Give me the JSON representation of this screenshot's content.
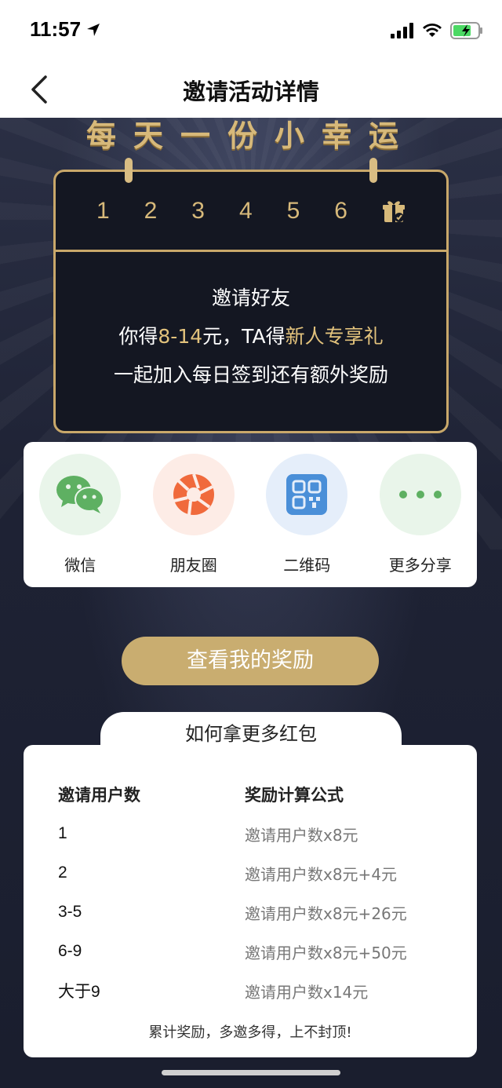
{
  "status_bar": {
    "time": "11:57"
  },
  "nav": {
    "title": "邀请活动详情"
  },
  "hero": {
    "slogan": "每天一份小幸运",
    "days": [
      "1",
      "2",
      "3",
      "4",
      "5",
      "6"
    ],
    "line1": "邀请好友",
    "line2_prefix": "你得",
    "line2_amount": "8-14",
    "line2_mid": "元，TA得",
    "line2_gift": "新人专享礼",
    "line3": "一起加入每日签到还有额外奖励"
  },
  "share": [
    {
      "label": "微信",
      "icon": "wechat-icon"
    },
    {
      "label": "朋友圈",
      "icon": "moments-icon"
    },
    {
      "label": "二维码",
      "icon": "qrcode-icon"
    },
    {
      "label": "更多分享",
      "icon": "more-icon"
    }
  ],
  "reward_button": "查看我的奖励",
  "rules": {
    "tab_title": "如何拿更多红包",
    "headers": [
      "邀请用户数",
      "奖励计算公式"
    ],
    "rows": [
      [
        "1",
        "邀请用户数x8元"
      ],
      [
        "2",
        "邀请用户数x8元+4元"
      ],
      [
        "3-5",
        "邀请用户数x8元+26元"
      ],
      [
        "6-9",
        "邀请用户数x8元+50元"
      ],
      [
        "大于9",
        "邀请用户数x14元"
      ]
    ],
    "note": "累计奖励，多邀多得，上不封顶!"
  },
  "colors": {
    "gold": "#d7b97a",
    "dark_bg": "#1b1f2f",
    "button": "#c9ad70"
  }
}
